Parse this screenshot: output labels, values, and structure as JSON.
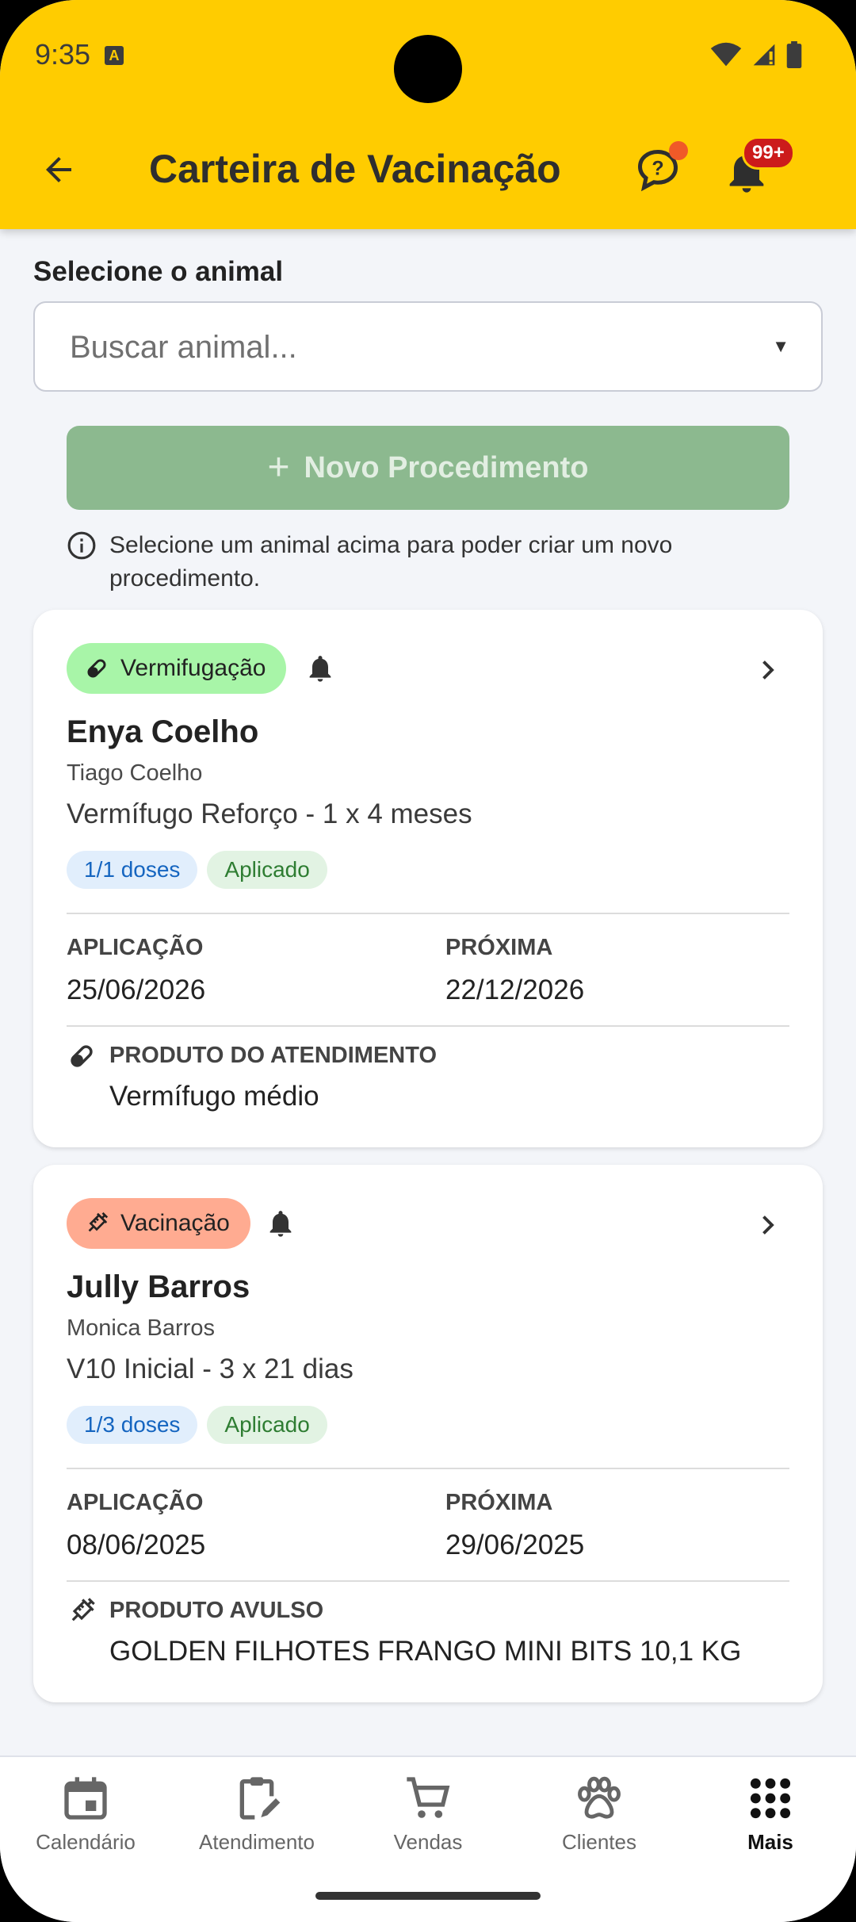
{
  "status_bar": {
    "time": "9:35",
    "app_glyph": "A"
  },
  "header": {
    "title": "Carteira de Vacinação",
    "back_icon": "arrow-back-icon",
    "help_icon": "help-chat-icon",
    "notification_icon": "bell-icon",
    "notification_badge": "99+"
  },
  "selector": {
    "label": "Selecione o animal",
    "placeholder": "Buscar animal...",
    "arrow": "▼"
  },
  "new_procedure": {
    "plus": "+",
    "label": "Novo Procedimento",
    "hint": "Selecione um animal acima para poder criar um novo procedimento."
  },
  "cards": [
    {
      "category": "Vermifugação",
      "category_icon": "pill-icon",
      "category_color": "#a8f5a8",
      "animal": "Enya Coelho",
      "owner": "Tiago Coelho",
      "protocol": "Vermífugo Reforço - 1 x 4 meses",
      "doses": "1/1 doses",
      "status": "Aplicado",
      "application_label": "APLICAÇÃO",
      "application_date": "25/06/2026",
      "next_label": "PRÓXIMA",
      "next_date": "22/12/2026",
      "product_label": "PRODUTO DO ATENDIMENTO",
      "product_icon": "pill-icon",
      "product": "Vermífugo médio"
    },
    {
      "category": "Vacinação",
      "category_icon": "syringe-icon",
      "category_color": "#ffab91",
      "animal": "Jully Barros",
      "owner": "Monica Barros",
      "protocol": "V10 Inicial - 3 x 21 dias",
      "doses": "1/3 doses",
      "status": "Aplicado",
      "application_label": "APLICAÇÃO",
      "application_date": "08/06/2025",
      "next_label": "PRÓXIMA",
      "next_date": "29/06/2025",
      "product_label": "PRODUTO AVULSO",
      "product_icon": "syringe-icon",
      "product": "GOLDEN FILHOTES FRANGO MINI BITS 10,1 KG"
    }
  ],
  "bottom_nav": [
    {
      "label": "Calendário",
      "icon": "calendar-icon",
      "active": false
    },
    {
      "label": "Atendimento",
      "icon": "clipboard-edit-icon",
      "active": false
    },
    {
      "label": "Vendas",
      "icon": "cart-icon",
      "active": false
    },
    {
      "label": "Clientes",
      "icon": "paw-icon",
      "active": false
    },
    {
      "label": "Mais",
      "icon": "apps-grid-icon",
      "active": true
    }
  ],
  "colors": {
    "header": "#ffcc00",
    "button_disabled": "#8cb98f",
    "badge": "#cc1b1b"
  }
}
